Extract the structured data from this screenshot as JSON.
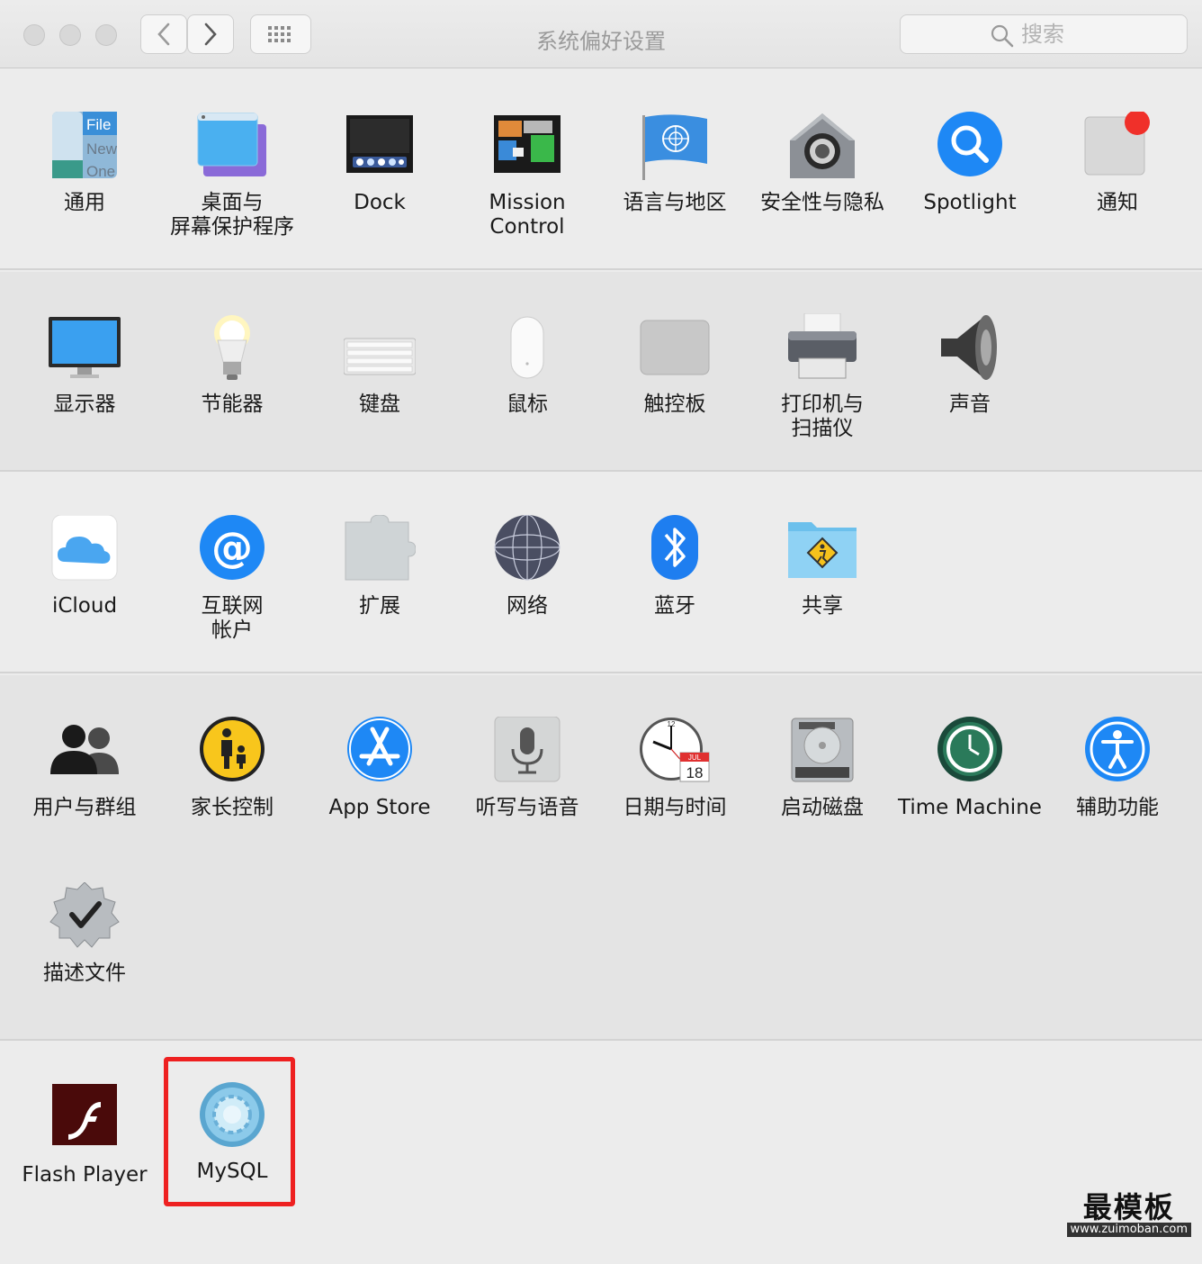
{
  "window": {
    "title": "系统偏好设置",
    "search_placeholder": "搜索"
  },
  "sections": [
    {
      "panes": [
        {
          "id": "general",
          "label": "通用",
          "icon": "general-icon"
        },
        {
          "id": "desktop",
          "label": "桌面与\n屏幕保护程序",
          "icon": "desktop-screensaver-icon"
        },
        {
          "id": "dock",
          "label": "Dock",
          "icon": "dock-icon"
        },
        {
          "id": "mission-control",
          "label": "Mission\nControl",
          "icon": "mission-control-icon"
        },
        {
          "id": "language",
          "label": "语言与地区",
          "icon": "un-flag-icon"
        },
        {
          "id": "security",
          "label": "安全性与隐私",
          "icon": "house-lock-icon"
        },
        {
          "id": "spotlight",
          "label": "Spotlight",
          "icon": "spotlight-icon"
        },
        {
          "id": "notifications",
          "label": "通知",
          "icon": "notifications-icon"
        }
      ]
    },
    {
      "panes": [
        {
          "id": "displays",
          "label": "显示器",
          "icon": "monitor-icon"
        },
        {
          "id": "energy",
          "label": "节能器",
          "icon": "lightbulb-icon"
        },
        {
          "id": "keyboard",
          "label": "键盘",
          "icon": "keyboard-icon"
        },
        {
          "id": "mouse",
          "label": "鼠标",
          "icon": "mouse-icon"
        },
        {
          "id": "trackpad",
          "label": "触控板",
          "icon": "trackpad-icon"
        },
        {
          "id": "printers",
          "label": "打印机与\n扫描仪",
          "icon": "printer-icon"
        },
        {
          "id": "sound",
          "label": "声音",
          "icon": "speaker-icon"
        }
      ]
    },
    {
      "panes": [
        {
          "id": "icloud",
          "label": "iCloud",
          "icon": "icloud-icon"
        },
        {
          "id": "internet-accounts",
          "label": "互联网\n帐户",
          "icon": "at-sign-icon"
        },
        {
          "id": "extensions",
          "label": "扩展",
          "icon": "puzzle-icon"
        },
        {
          "id": "network",
          "label": "网络",
          "icon": "globe-icon"
        },
        {
          "id": "bluetooth",
          "label": "蓝牙",
          "icon": "bluetooth-icon"
        },
        {
          "id": "sharing",
          "label": "共享",
          "icon": "sharing-folder-icon"
        }
      ]
    },
    {
      "panes": [
        {
          "id": "users",
          "label": "用户与群组",
          "icon": "users-icon"
        },
        {
          "id": "parental",
          "label": "家长控制",
          "icon": "parental-controls-icon"
        },
        {
          "id": "appstore",
          "label": "App Store",
          "icon": "app-store-icon"
        },
        {
          "id": "dictation",
          "label": "听写与语音",
          "icon": "microphone-icon"
        },
        {
          "id": "datetime",
          "label": "日期与时间",
          "icon": "clock-calendar-icon"
        },
        {
          "id": "startup",
          "label": "启动磁盘",
          "icon": "hard-drive-icon"
        },
        {
          "id": "timemachine",
          "label": "Time Machine",
          "icon": "time-machine-icon"
        },
        {
          "id": "accessibility",
          "label": "辅助功能",
          "icon": "accessibility-icon"
        },
        {
          "id": "profiles",
          "label": "描述文件",
          "icon": "profiles-badge-icon"
        }
      ]
    },
    {
      "panes": [
        {
          "id": "flash",
          "label": "Flash Player",
          "icon": "flash-player-icon"
        },
        {
          "id": "mysql",
          "label": "MySQL",
          "icon": "mysql-gear-icon"
        }
      ]
    }
  ],
  "icon_glyphs": {
    "general_file": "File",
    "general_new": "New",
    "general_one": "One",
    "calendar_month": "JUL",
    "calendar_day": "18",
    "clock_12": "12"
  },
  "watermark": {
    "text": "最模板",
    "url": "www.zuimoban.com"
  },
  "colors": {
    "highlight": "#ee2020",
    "accent_blue": "#1e88f5"
  }
}
